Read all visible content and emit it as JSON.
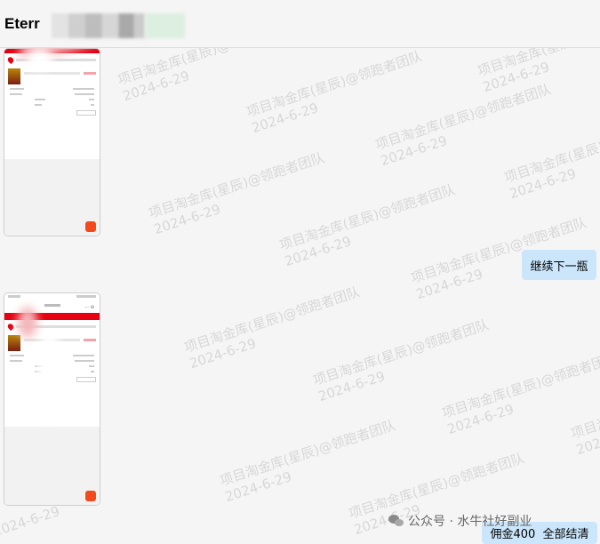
{
  "header": {
    "title": "Eterr"
  },
  "watermark": {
    "text": "项目淘金库(星辰)@领跑者团队",
    "date": "2024-6-29"
  },
  "messages": {
    "next_bottle": "继续下一瓶",
    "commission": "佣金400  全部结清"
  },
  "footer": {
    "brand": "公众号 · 水牛社好副业"
  },
  "colors": {
    "bubble": "#cbe6fb",
    "brand_red": "#e60012"
  }
}
